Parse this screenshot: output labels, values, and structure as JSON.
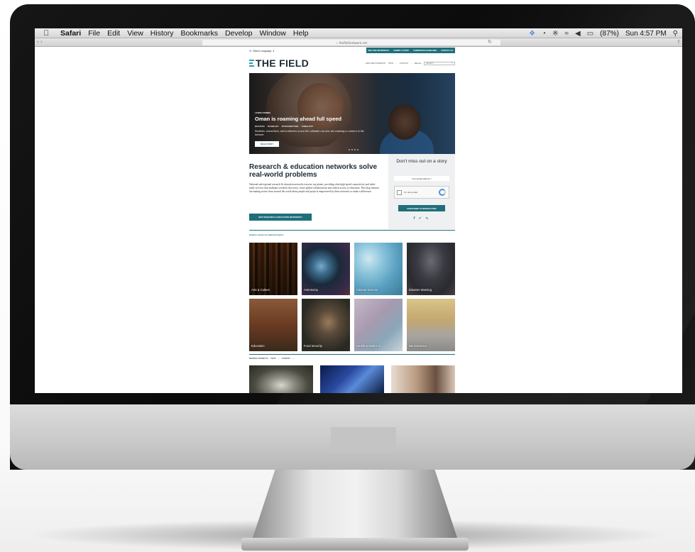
{
  "menubar": {
    "app_name": "Safari",
    "items": [
      "File",
      "Edit",
      "View",
      "History",
      "Bookmarks",
      "Develop",
      "Window",
      "Help"
    ],
    "battery": "(87%)",
    "clock": "Sun 4:57 PM"
  },
  "browser": {
    "url": "☆ thefieldnetwork.net"
  },
  "site": {
    "language_label": "Select Language",
    "top_nav": [
      "WHY R&E NETWORKS?",
      "SUBMIT A STORY",
      "SUBMISSION GUIDELINES",
      "CONTACT US"
    ],
    "logo_text": "THE FIELD",
    "explore": {
      "label": "EXPLORE STORIES BY",
      "topic": "TOPIC",
      "country": "COUNTRY",
      "see_all": "SEE ALL",
      "search_placeholder": "SEARCH..."
    },
    "hero": {
      "kicker": "LATEST STORIES",
      "title": "Oman is roaming ahead full speed",
      "tags": [
        "EDUCATION",
        "TECHNOLOGY",
        "INTERCONNECTIONS",
        "CONNECTIVITY"
      ],
      "description": "Students, researchers, and academics across the sultanate can now use roaming to connect to the internet.",
      "button": "READ STORY"
    },
    "intro": {
      "heading": "Research & education networks solve real-world problems",
      "body": "National and regional research & education networks traverse our planet, providing ultra high-speed connectivity and tailor-made services that underpin scientific discovery, foster global collaborations and unlock access to education. This blog features fascinating stories from around the world about people and projects empowered by these networks to make a difference.",
      "cta": "WHY RESEARCH & EDUCATION NETWORKS?"
    },
    "newsletter": {
      "title": "Don't miss out on a story",
      "email_placeholder": "Your Email Address *",
      "captcha_label": "I'm not a robot",
      "button": "SUBSCRIBE TO NEWSLETTER",
      "social": "f  ✓  ≡"
    },
    "featured": {
      "label": "Explore stories by featured topics",
      "tiles": [
        {
          "label": "Arts & Culture"
        },
        {
          "label": "Astronomy"
        },
        {
          "label": "Climate Science"
        },
        {
          "label": "Disaster Warning"
        },
        {
          "label": "Education"
        },
        {
          "label": "Food Security"
        },
        {
          "label": "Health & Medicine"
        },
        {
          "label": "Neuroscience"
        }
      ]
    },
    "browse": {
      "label": "BROWSE STORIES BY",
      "topic": "TOPIC",
      "country": "COUNTRY"
    }
  },
  "colors": {
    "accent": "#1f6f7a",
    "logo_text": "#1d2b36",
    "logo_mark": "#2aa0a8"
  }
}
